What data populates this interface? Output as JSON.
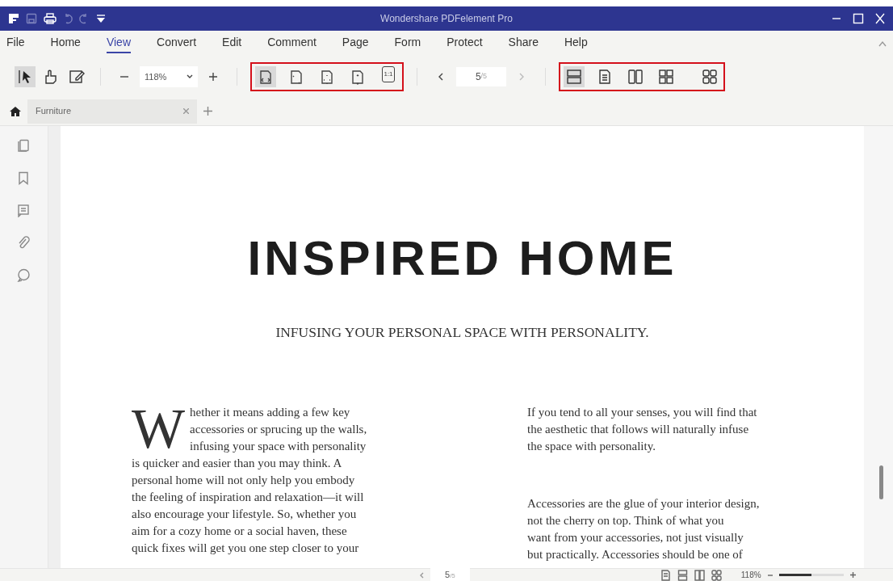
{
  "window": {
    "title": "Wondershare PDFelement Pro"
  },
  "menu": [
    {
      "label": "File",
      "selected": false
    },
    {
      "label": "Home",
      "selected": false
    },
    {
      "label": "View",
      "selected": true
    },
    {
      "label": "Convert",
      "selected": false
    },
    {
      "label": "Edit",
      "selected": false
    },
    {
      "label": "Comment",
      "selected": false
    },
    {
      "label": "Page",
      "selected": false
    },
    {
      "label": "Form",
      "selected": false
    },
    {
      "label": "Protect",
      "selected": false
    },
    {
      "label": "Share",
      "selected": false
    },
    {
      "label": "Help",
      "selected": false
    }
  ],
  "toolbar": {
    "tools": [
      {
        "kind": "select",
        "selected": true
      },
      {
        "kind": "hand",
        "selected": false
      },
      {
        "kind": "edit",
        "selected": false
      }
    ],
    "zoom": {
      "value": "118%"
    },
    "fit_group": {
      "highlighted": true,
      "buttons": [
        {
          "kind": "fit-width",
          "selected": true
        },
        {
          "kind": "fit-page",
          "selected": false
        },
        {
          "kind": "fit-visible",
          "selected": false
        },
        {
          "kind": "fit-height",
          "selected": false
        },
        {
          "kind": "actual-size",
          "label": "1:1",
          "selected": false
        }
      ]
    },
    "page": {
      "current": "5",
      "total": "/5"
    },
    "layout_group": {
      "highlighted": true,
      "buttons": [
        {
          "kind": "single-scroll",
          "selected": true
        },
        {
          "kind": "single",
          "selected": false
        },
        {
          "kind": "two-page",
          "selected": false
        },
        {
          "kind": "two-scroll",
          "selected": false
        },
        {
          "kind": "thumbnails",
          "selected": false
        }
      ]
    }
  },
  "tabs": [
    {
      "label": "Furniture",
      "selected": true
    }
  ],
  "document": {
    "heading": "INSPIRED HOME",
    "subtitle": "INFUSING YOUR PERSONAL SPACE WITH PERSONALITY.",
    "columns": [
      {
        "paragraphs": [
          {
            "drop_cap": "W",
            "lines": [
              "hether it means adding a few key",
              "accessories or sprucing up the walls,",
              "infusing your space with personality",
              "is quicker and easier than you may think. A",
              "personal home will not only help you embody",
              "the feeling of inspiration and relaxation—it will",
              "also encourage your lifestyle. So, whether you",
              "aim for a cozy home or a social haven, these",
              "quick fixes will get you one step closer to your"
            ]
          }
        ]
      },
      {
        "paragraphs": [
          {
            "lines": [
              "If you tend to all your senses, you will find that",
              "the aesthetic that follows will naturally infuse",
              "the space with personality."
            ]
          },
          {
            "lines": [
              "Accessories are the glue of your interior design,",
              "not the cherry on top. Think of what you",
              "want from your accessories, not just visually",
              "but practically. Accessories should be one of"
            ]
          }
        ]
      }
    ]
  },
  "status_bar": {
    "page": {
      "current": "5",
      "total": "/5"
    },
    "zoom": "118%",
    "zoom_slider": {
      "level": 0.5
    }
  }
}
